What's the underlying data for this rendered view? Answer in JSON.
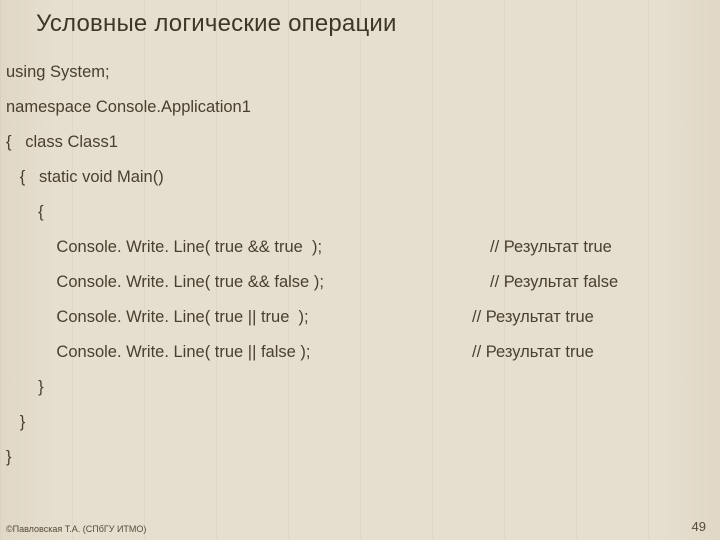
{
  "title": "Условные логические операции",
  "lines": {
    "l1": "using System;",
    "l2": "namespace Console.Application1",
    "l3": "{   class Class1",
    "l4": "   {   static void Main()",
    "l5": "       {",
    "l6": "           Console. Write. Line( true && true  );",
    "l7": "           Console. Write. Line( true && false );",
    "l8": "           Console. Write. Line( true || true  );",
    "l9": "           Console. Write. Line( true || false );",
    "l10": "       }",
    "l11": "   }",
    "l12": "}"
  },
  "comments": {
    "c6": "// Результат true",
    "c7": "// Результат false",
    "c8": "// Результат true",
    "c9": "// Результат true"
  },
  "footer": "©Павловская Т.А. (СПбГУ ИТМО)",
  "page": "49"
}
